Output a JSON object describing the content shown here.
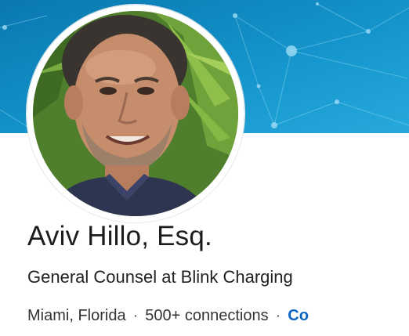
{
  "profile": {
    "name": "Aviv Hillo, Esq.",
    "headline": "General Counsel at Blink Charging",
    "location": "Miami, Florida",
    "separator": "·",
    "connections": "500+ connections",
    "contact_link_partial": "Co"
  },
  "banner": {
    "icon": "network-pattern-banner",
    "colors": [
      "#0b7fb8",
      "#1e9fd3",
      "#5fc1e8"
    ]
  },
  "avatar": {
    "icon": "profile-photo"
  },
  "colors": {
    "link": "#0a66c2",
    "name": "#1d1d1d"
  }
}
